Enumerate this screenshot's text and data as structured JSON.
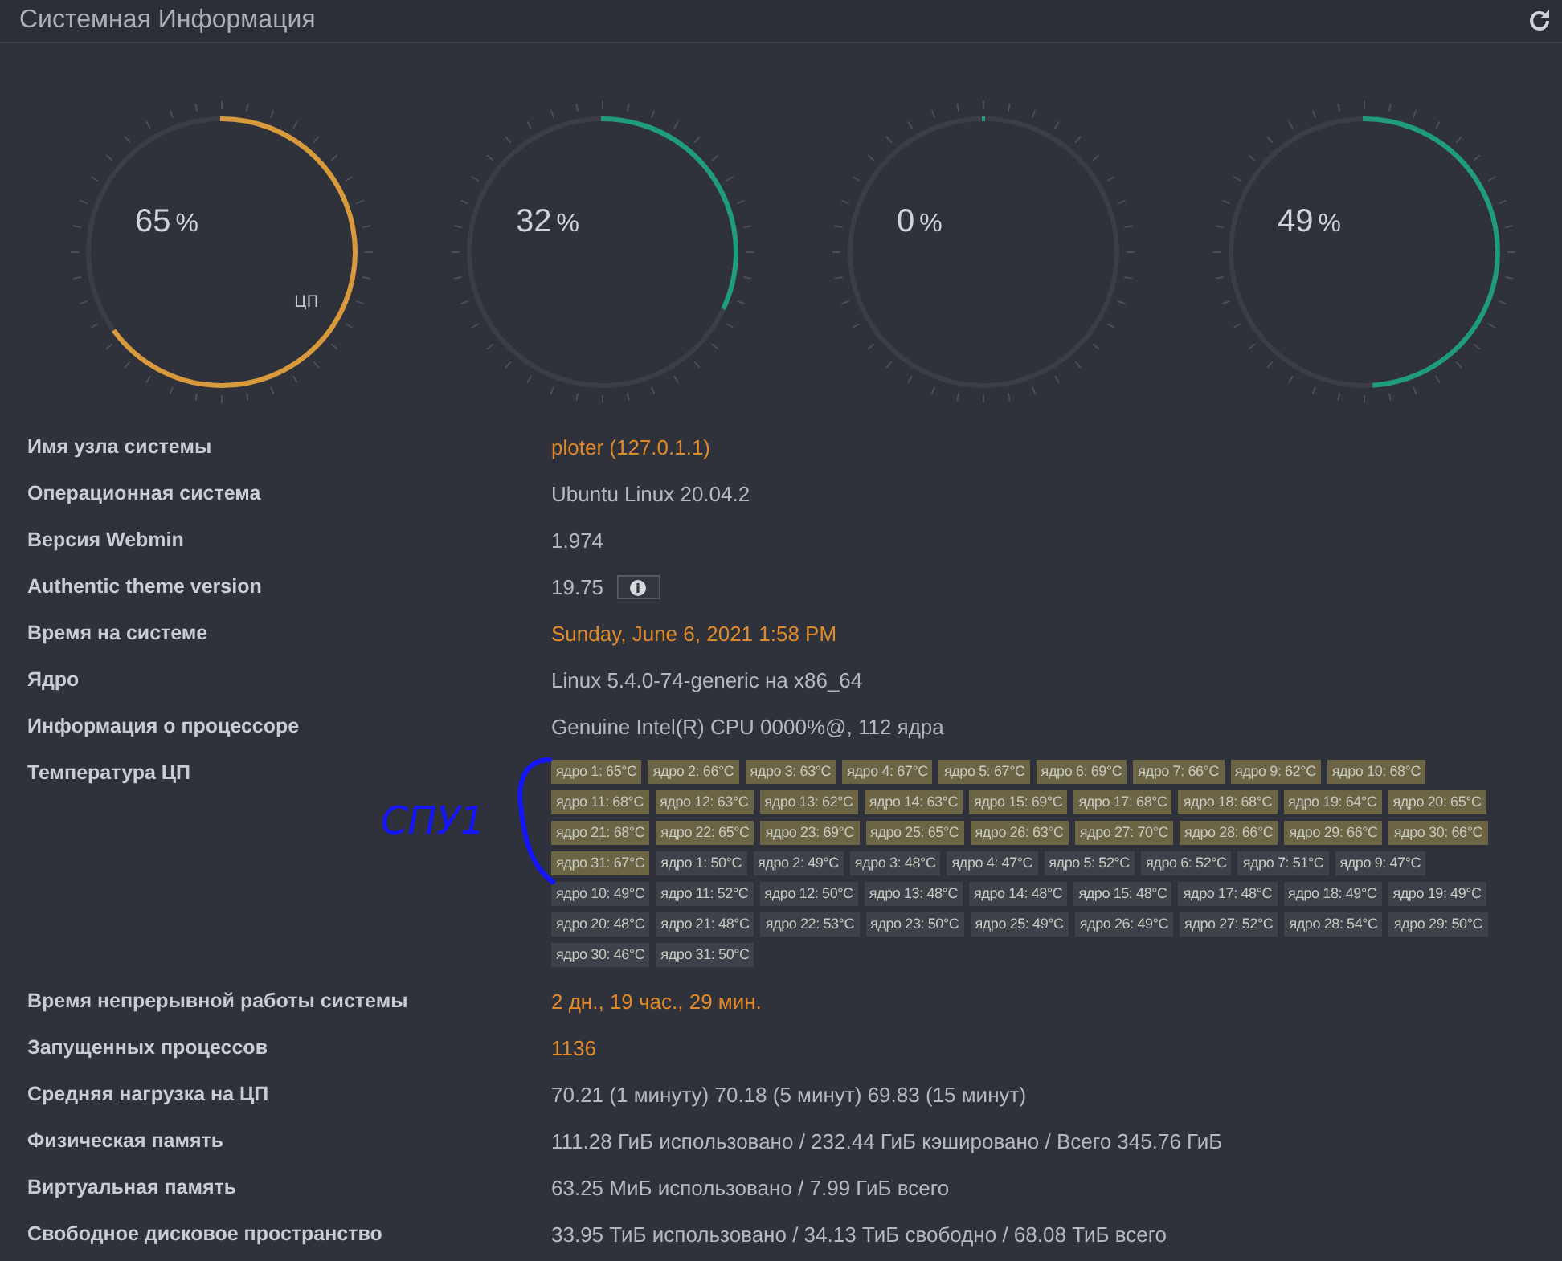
{
  "header": {
    "title": "Системная Информация"
  },
  "gauges": [
    {
      "value": "65",
      "unit": "%",
      "level": 0.65,
      "color": "#d99a3c",
      "caption": "ЦП"
    },
    {
      "value": "32",
      "unit": "%",
      "level": 0.32,
      "color": "#1f9c7a"
    },
    {
      "value": "0",
      "unit": "%",
      "level": 0,
      "color": "#1f9c7a"
    },
    {
      "value": "49",
      "unit": "%",
      "level": 0.49,
      "color": "#1f9c7a"
    }
  ],
  "info": [
    {
      "kind": "text",
      "label": "Имя узла системы",
      "value": "ploter (127.0.1.1)",
      "link": true
    },
    {
      "kind": "text",
      "label": "Операционная система",
      "value": "Ubuntu Linux 20.04.2",
      "link": false
    },
    {
      "kind": "text",
      "label": "Версия Webmin",
      "value": "1.974",
      "link": false
    },
    {
      "kind": "info",
      "label": "Authentic theme version",
      "value": "19.75",
      "link": false
    },
    {
      "kind": "text",
      "label": "Время на системе",
      "value": "Sunday, June 6, 2021 1:58 PM",
      "link": true
    },
    {
      "kind": "text",
      "label": "Ядро",
      "value": "Linux 5.4.0-74-generic на x86_64",
      "link": false
    },
    {
      "kind": "text",
      "label": "Информация о процессоре",
      "value": "Genuine Intel(R) CPU 0000%@, 112 ядра",
      "link": false
    },
    {
      "kind": "temps",
      "label": "Температура ЦП",
      "groups": [
        {
          "color": "#6b6445",
          "badges": [
            "ядро 1: 65°C",
            "ядро 2: 66°C",
            "ядро 3: 63°C",
            "ядро 4: 67°C",
            "ядро 5: 67°C",
            "ядро 6: 69°C",
            "ядро 7: 66°C",
            "ядро 9: 62°C",
            "ядро 10: 68°C",
            "ядро 11: 68°C",
            "ядро 12: 63°C",
            "ядро 13: 62°C",
            "ядро 14: 63°C",
            "ядро 15: 69°C",
            "ядро 17: 68°C",
            "ядро 18: 68°C",
            "ядро 19: 64°C",
            "ядро 20: 65°C",
            "ядро 21: 68°C",
            "ядро 22: 65°C",
            "ядро 23: 69°C",
            "ядро 25: 65°C",
            "ядро 26: 63°C",
            "ядро 27: 70°C",
            "ядро 28: 66°C",
            "ядро 29: 66°C",
            "ядро 30: 66°C",
            "ядро 31: 67°C"
          ]
        },
        {
          "color": "#3c414a",
          "badges": [
            "ядро 1: 50°C",
            "ядро 2: 49°C",
            "ядро 3: 48°C",
            "ядро 4: 47°C",
            "ядро 5: 52°C",
            "ядро 6: 52°C",
            "ядро 7: 51°C",
            "ядро 9: 47°C",
            "ядро 10: 49°C",
            "ядро 11: 52°C",
            "ядро 12: 50°C",
            "ядро 13: 48°C",
            "ядро 14: 48°C",
            "ядро 15: 48°C",
            "ядро 17: 48°C",
            "ядро 18: 49°C",
            "ядро 19: 49°C",
            "ядро 20: 48°C",
            "ядро 21: 48°C",
            "ядро 22: 53°C",
            "ядро 23: 50°C",
            "ядро 25: 49°C",
            "ядро 26: 49°C",
            "ядро 27: 52°C",
            "ядро 28: 54°C",
            "ядро 29: 50°C",
            "ядро 30: 46°C",
            "ядро 31: 50°C"
          ]
        }
      ]
    },
    {
      "kind": "text",
      "label": "Время непрерывной работы системы",
      "value": "2 дн., 19 час., 29 мин.",
      "link": true
    },
    {
      "kind": "text",
      "label": "Запущенных процессов",
      "value": "1136",
      "link": true
    },
    {
      "kind": "text",
      "label": "Средняя нагрузка на ЦП",
      "value": "70.21 (1 минуту) 70.18 (5 минут) 69.83 (15 минут)",
      "link": false
    },
    {
      "kind": "text",
      "label": "Физическая память",
      "value": "111.28 ГиБ использовано / 232.44 ГиБ кэшировано / Всего 345.76 ГиБ",
      "link": false
    },
    {
      "kind": "text",
      "label": "Виртуальная память",
      "value": "63.25 МиБ использовано / 7.99 ГиБ всего",
      "link": false
    },
    {
      "kind": "text",
      "label": "Свободное дисковое пространство",
      "value": "33.95 ТиБ использовано / 34.13 ТиБ свободно / 68.08 ТиБ всего",
      "link": false
    }
  ],
  "annotation": {
    "text": "СПУ1"
  }
}
